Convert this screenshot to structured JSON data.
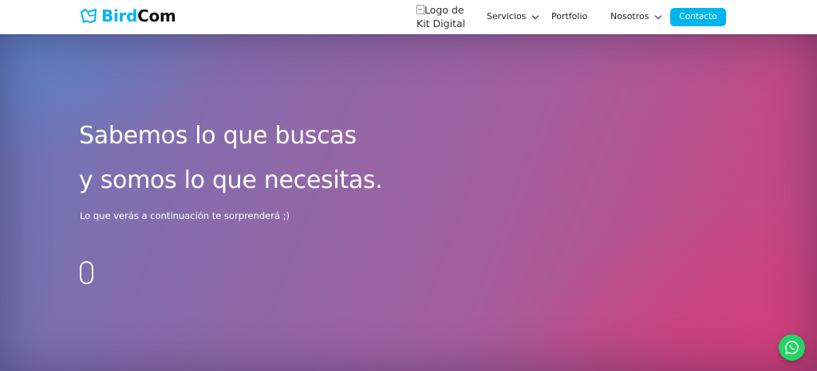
{
  "header": {
    "brand": {
      "part1": "Bird",
      "part2": "Com",
      "icon": "bird-logo-icon",
      "colors": {
        "bird": "#00b4f0",
        "com": "#111111"
      }
    },
    "kit_logo_alt": "Logo de Kit Digital",
    "nav": {
      "servicios": "Servicios",
      "portfolio": "Portfolio",
      "nosotros": "Nosotros"
    },
    "contact_label": "Contacto",
    "accent_color": "#00b4f0"
  },
  "hero": {
    "title_line1": "Sabemos lo que buscas",
    "title_line2": "y somos lo que necesitas.",
    "subtitle": "Lo que verás a continuación te sorprenderá ;)",
    "scroll_icon": "scroll-mouse-icon",
    "gradient": [
      "#6b78b8",
      "#a45f9e",
      "#c94882"
    ]
  },
  "floating": {
    "whatsapp_icon": "whatsapp-icon",
    "whatsapp_color": "#25d366"
  }
}
